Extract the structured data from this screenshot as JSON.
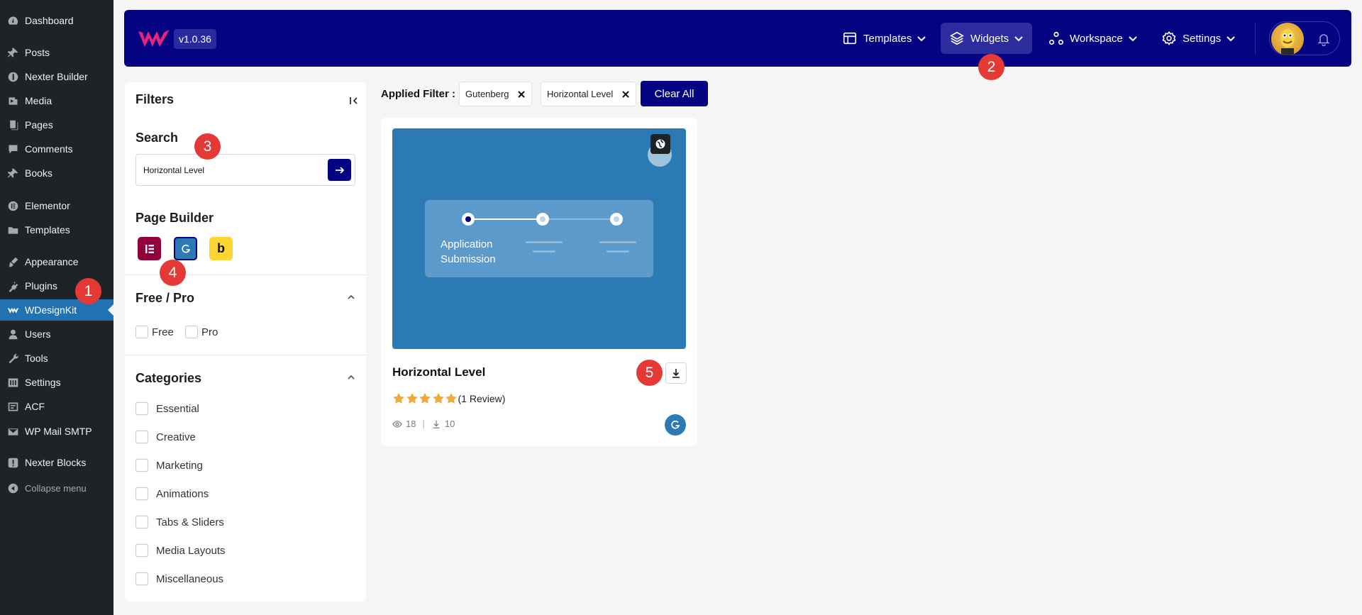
{
  "wp_menu": [
    {
      "label": "Dashboard",
      "icon": "dashboard-icon"
    },
    {
      "label": "Posts",
      "icon": "pin-icon"
    },
    {
      "label": "Nexter Builder",
      "icon": "nexter-icon"
    },
    {
      "label": "Media",
      "icon": "media-icon"
    },
    {
      "label": "Pages",
      "icon": "pages-icon"
    },
    {
      "label": "Comments",
      "icon": "comment-icon"
    },
    {
      "label": "Books",
      "icon": "pin-icon"
    },
    {
      "label": "Elementor",
      "icon": "elementor-icon"
    },
    {
      "label": "Templates",
      "icon": "folder-icon"
    },
    {
      "label": "Appearance",
      "icon": "brush-icon"
    },
    {
      "label": "Plugins",
      "icon": "plug-icon"
    },
    {
      "label": "WDesignKit",
      "icon": "wdesignkit-icon"
    },
    {
      "label": "Users",
      "icon": "user-icon"
    },
    {
      "label": "Tools",
      "icon": "wrench-icon"
    },
    {
      "label": "Settings",
      "icon": "settings-icon"
    },
    {
      "label": "ACF",
      "icon": "acf-icon"
    },
    {
      "label": "WP Mail SMTP",
      "icon": "mail-icon"
    },
    {
      "label": "Nexter Blocks",
      "icon": "exclamation-icon"
    },
    {
      "label": "Collapse menu",
      "icon": "collapse-icon"
    }
  ],
  "header": {
    "version": "v1.0.36",
    "nav": {
      "templates": "Templates",
      "widgets": "Widgets",
      "workspace": "Workspace",
      "settings": "Settings"
    }
  },
  "filters": {
    "title": "Filters",
    "search": {
      "heading": "Search",
      "value": "Horizontal Level"
    },
    "page_builder": {
      "heading": "Page Builder",
      "letter_b": "b"
    },
    "free_pro": {
      "heading": "Free / Pro",
      "options": [
        "Free",
        "Pro"
      ]
    },
    "categories": {
      "heading": "Categories",
      "options": [
        "Essential",
        "Creative",
        "Marketing",
        "Animations",
        "Tabs & Sliders",
        "Media Layouts",
        "Miscellaneous"
      ]
    }
  },
  "applied": {
    "label": "Applied Filter :",
    "chips": [
      "Gutenberg",
      "Horizontal Level"
    ],
    "clear_all": "Clear All"
  },
  "card": {
    "title": "Horizontal Level",
    "preview_caption": "Application Submission",
    "rating": 5,
    "review_text": "(1 Review)",
    "views": "18",
    "downloads": "10"
  },
  "markers": [
    "1",
    "2",
    "3",
    "4",
    "5"
  ],
  "colors": {
    "brand": "#040483",
    "wp_sidebar": "#1d2327",
    "wp_active": "#2271b1",
    "preview": "#2c7ab3",
    "marker": "#e53935",
    "star": "#f2a93b",
    "elementor": "#92003b",
    "beaver": "#fcd535"
  }
}
